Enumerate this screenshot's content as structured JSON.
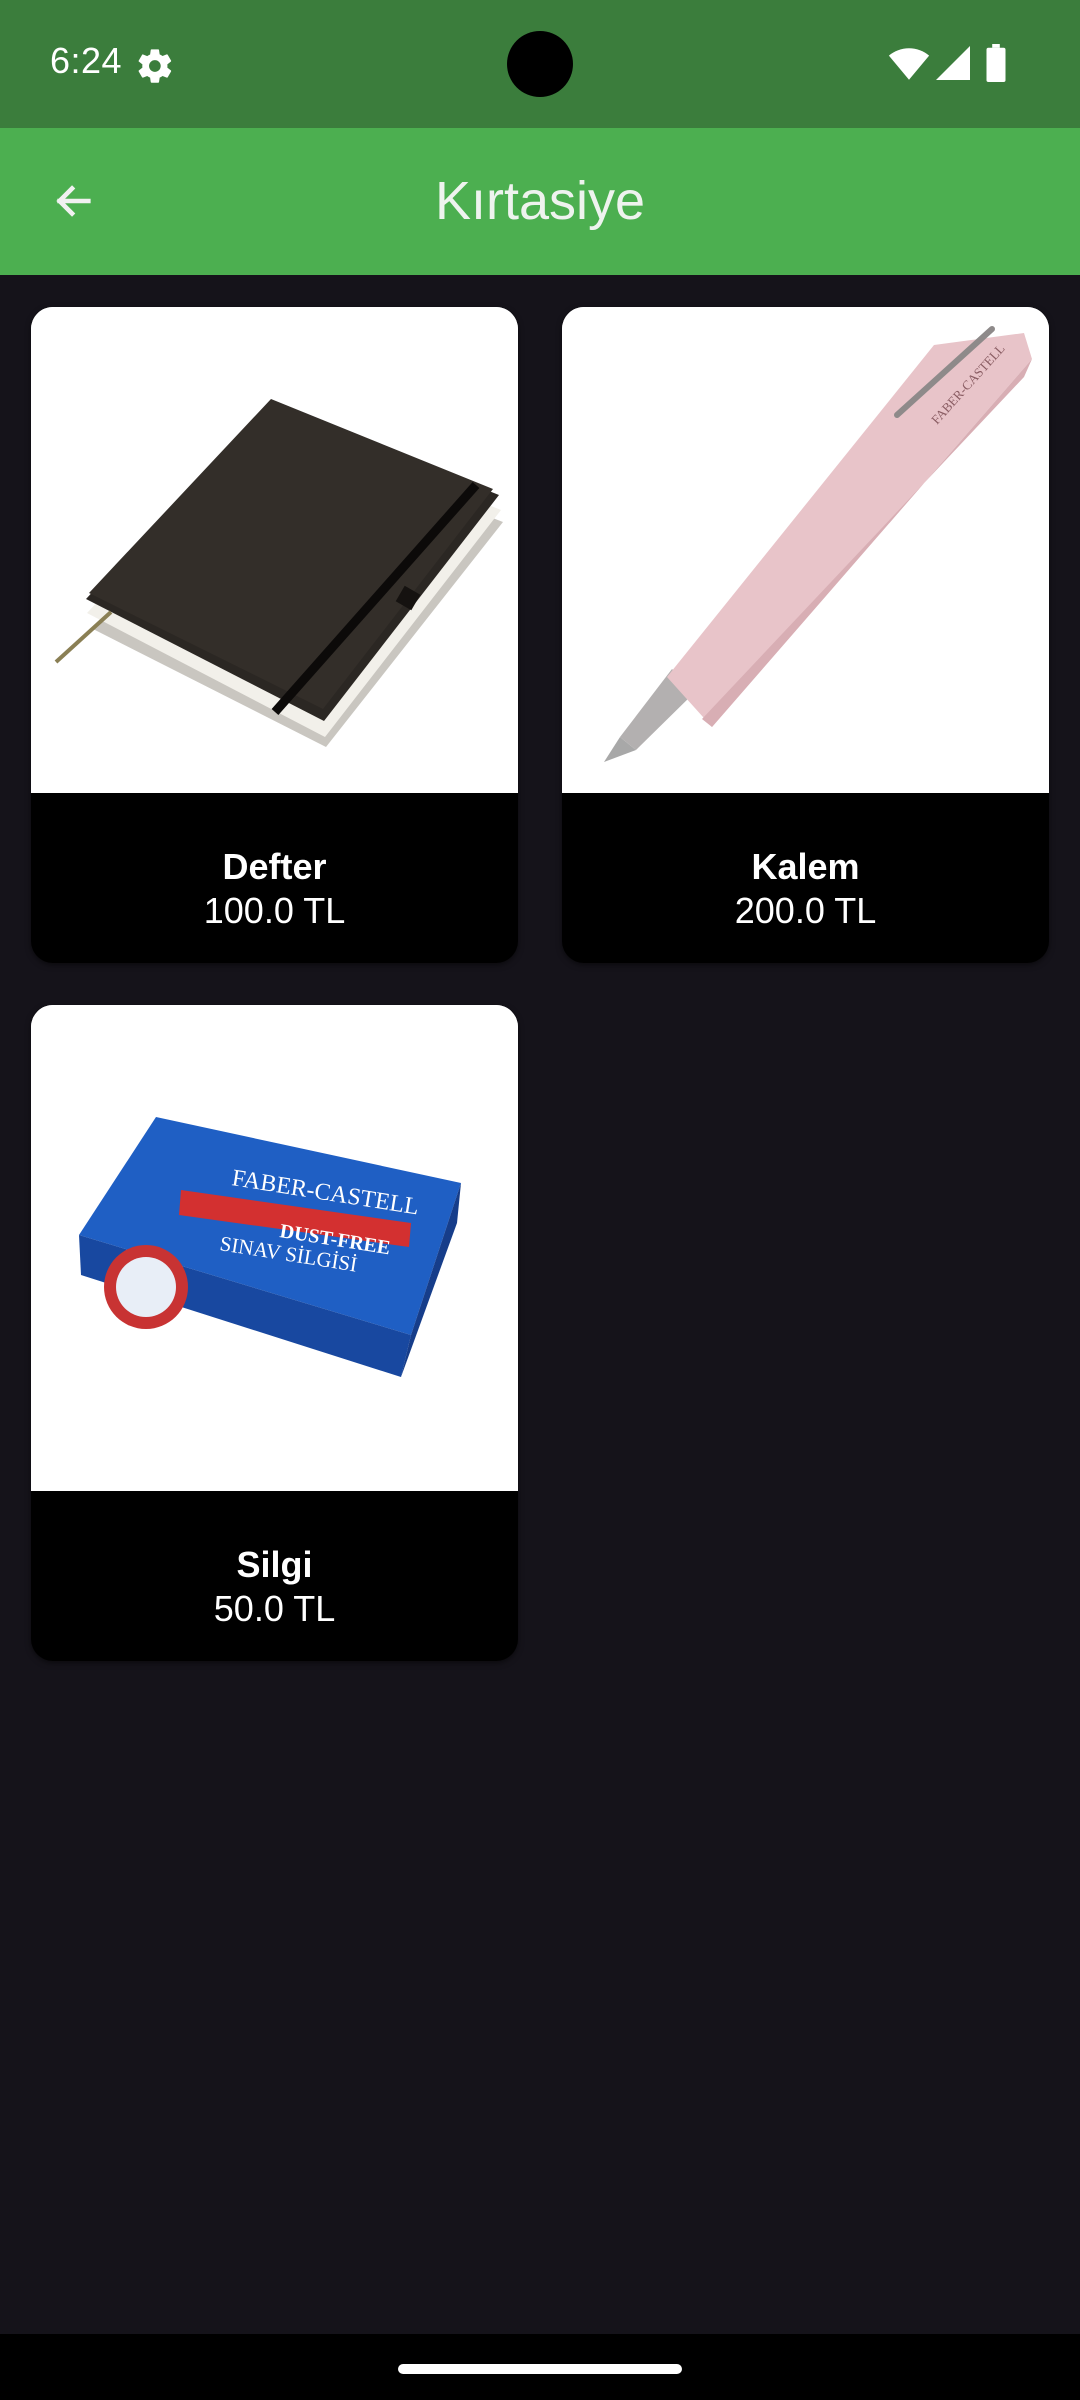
{
  "status_bar": {
    "time": "6:24",
    "icons": [
      "gear-icon",
      "wifi-icon",
      "signal-icon",
      "battery-icon"
    ]
  },
  "app_bar": {
    "title": "Kırtasiye",
    "back_icon": "arrow-left-icon",
    "background": "#4caf50"
  },
  "products": [
    {
      "name": "Defter",
      "price": "100.0 TL",
      "image": "notebook"
    },
    {
      "name": "Kalem",
      "price": "200.0 TL",
      "image": "fountain-pen"
    },
    {
      "name": "Silgi",
      "price": "50.0 TL",
      "image": "eraser"
    }
  ],
  "eraser_print": {
    "brand": "FABER-CASTELL",
    "tag": "DUST-FREE",
    "line": "SINAV SİLGİSİ"
  },
  "pen_print": "FABER-CASTELL",
  "colors": {
    "status_bar": "#3b7d3c",
    "background": "#15131a",
    "card": "#000000"
  }
}
